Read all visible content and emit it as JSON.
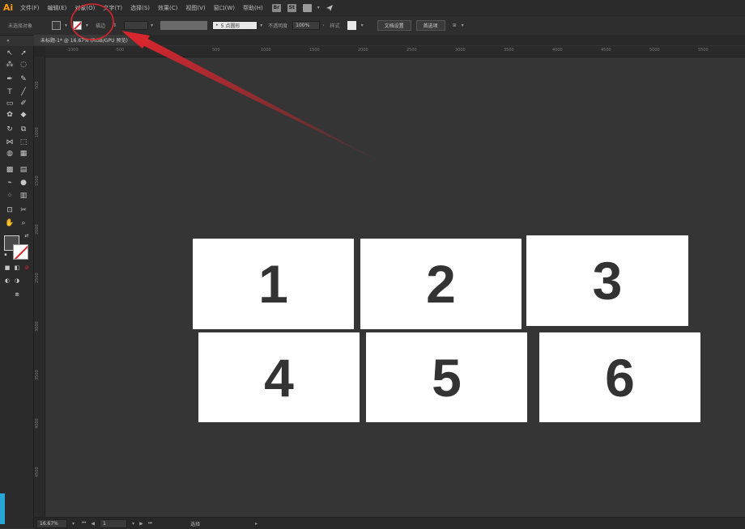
{
  "app": {
    "logo": "Ai"
  },
  "menubar": {
    "items": [
      "文件(F)",
      "编辑(E)",
      "对象(O)",
      "文字(T)",
      "选择(S)",
      "效果(C)",
      "视图(V)",
      "窗口(W)",
      "帮助(H)"
    ],
    "icons": [
      "Br",
      "St"
    ]
  },
  "control_bar": {
    "selection_label": "未选择对象",
    "stroke_label": "描边",
    "brush_value": "5 点圆形",
    "opacity_label": "不透明度",
    "opacity_value": "100%",
    "style_label": "样式",
    "doc_setup_button": "文档设置",
    "preferences_button": "首选项"
  },
  "document_tab": {
    "title": "未标题-1* @ 16.67% (RGB/GPU 预览)",
    "close": "×"
  },
  "ruler": {
    "top_ticks": [
      "-1000",
      "-500",
      "0",
      "500",
      "1000",
      "1500",
      "2000",
      "2500",
      "3000",
      "3500",
      "4000",
      "4500",
      "5000",
      "5500"
    ],
    "left_ticks": [
      "500",
      "1000",
      "1500",
      "2000",
      "2500",
      "3000",
      "3500",
      "4000",
      "4500"
    ]
  },
  "artboards": [
    {
      "label": "1"
    },
    {
      "label": "2"
    },
    {
      "label": "3"
    },
    {
      "label": "4"
    },
    {
      "label": "5"
    },
    {
      "label": "6"
    }
  ],
  "statusbar": {
    "zoom": "16.67%",
    "artboard_num": "1",
    "tool_status": "选择"
  },
  "colors": {
    "annotation_red": "#d8262e",
    "card_text": "#333333",
    "canvas": "#353535"
  }
}
